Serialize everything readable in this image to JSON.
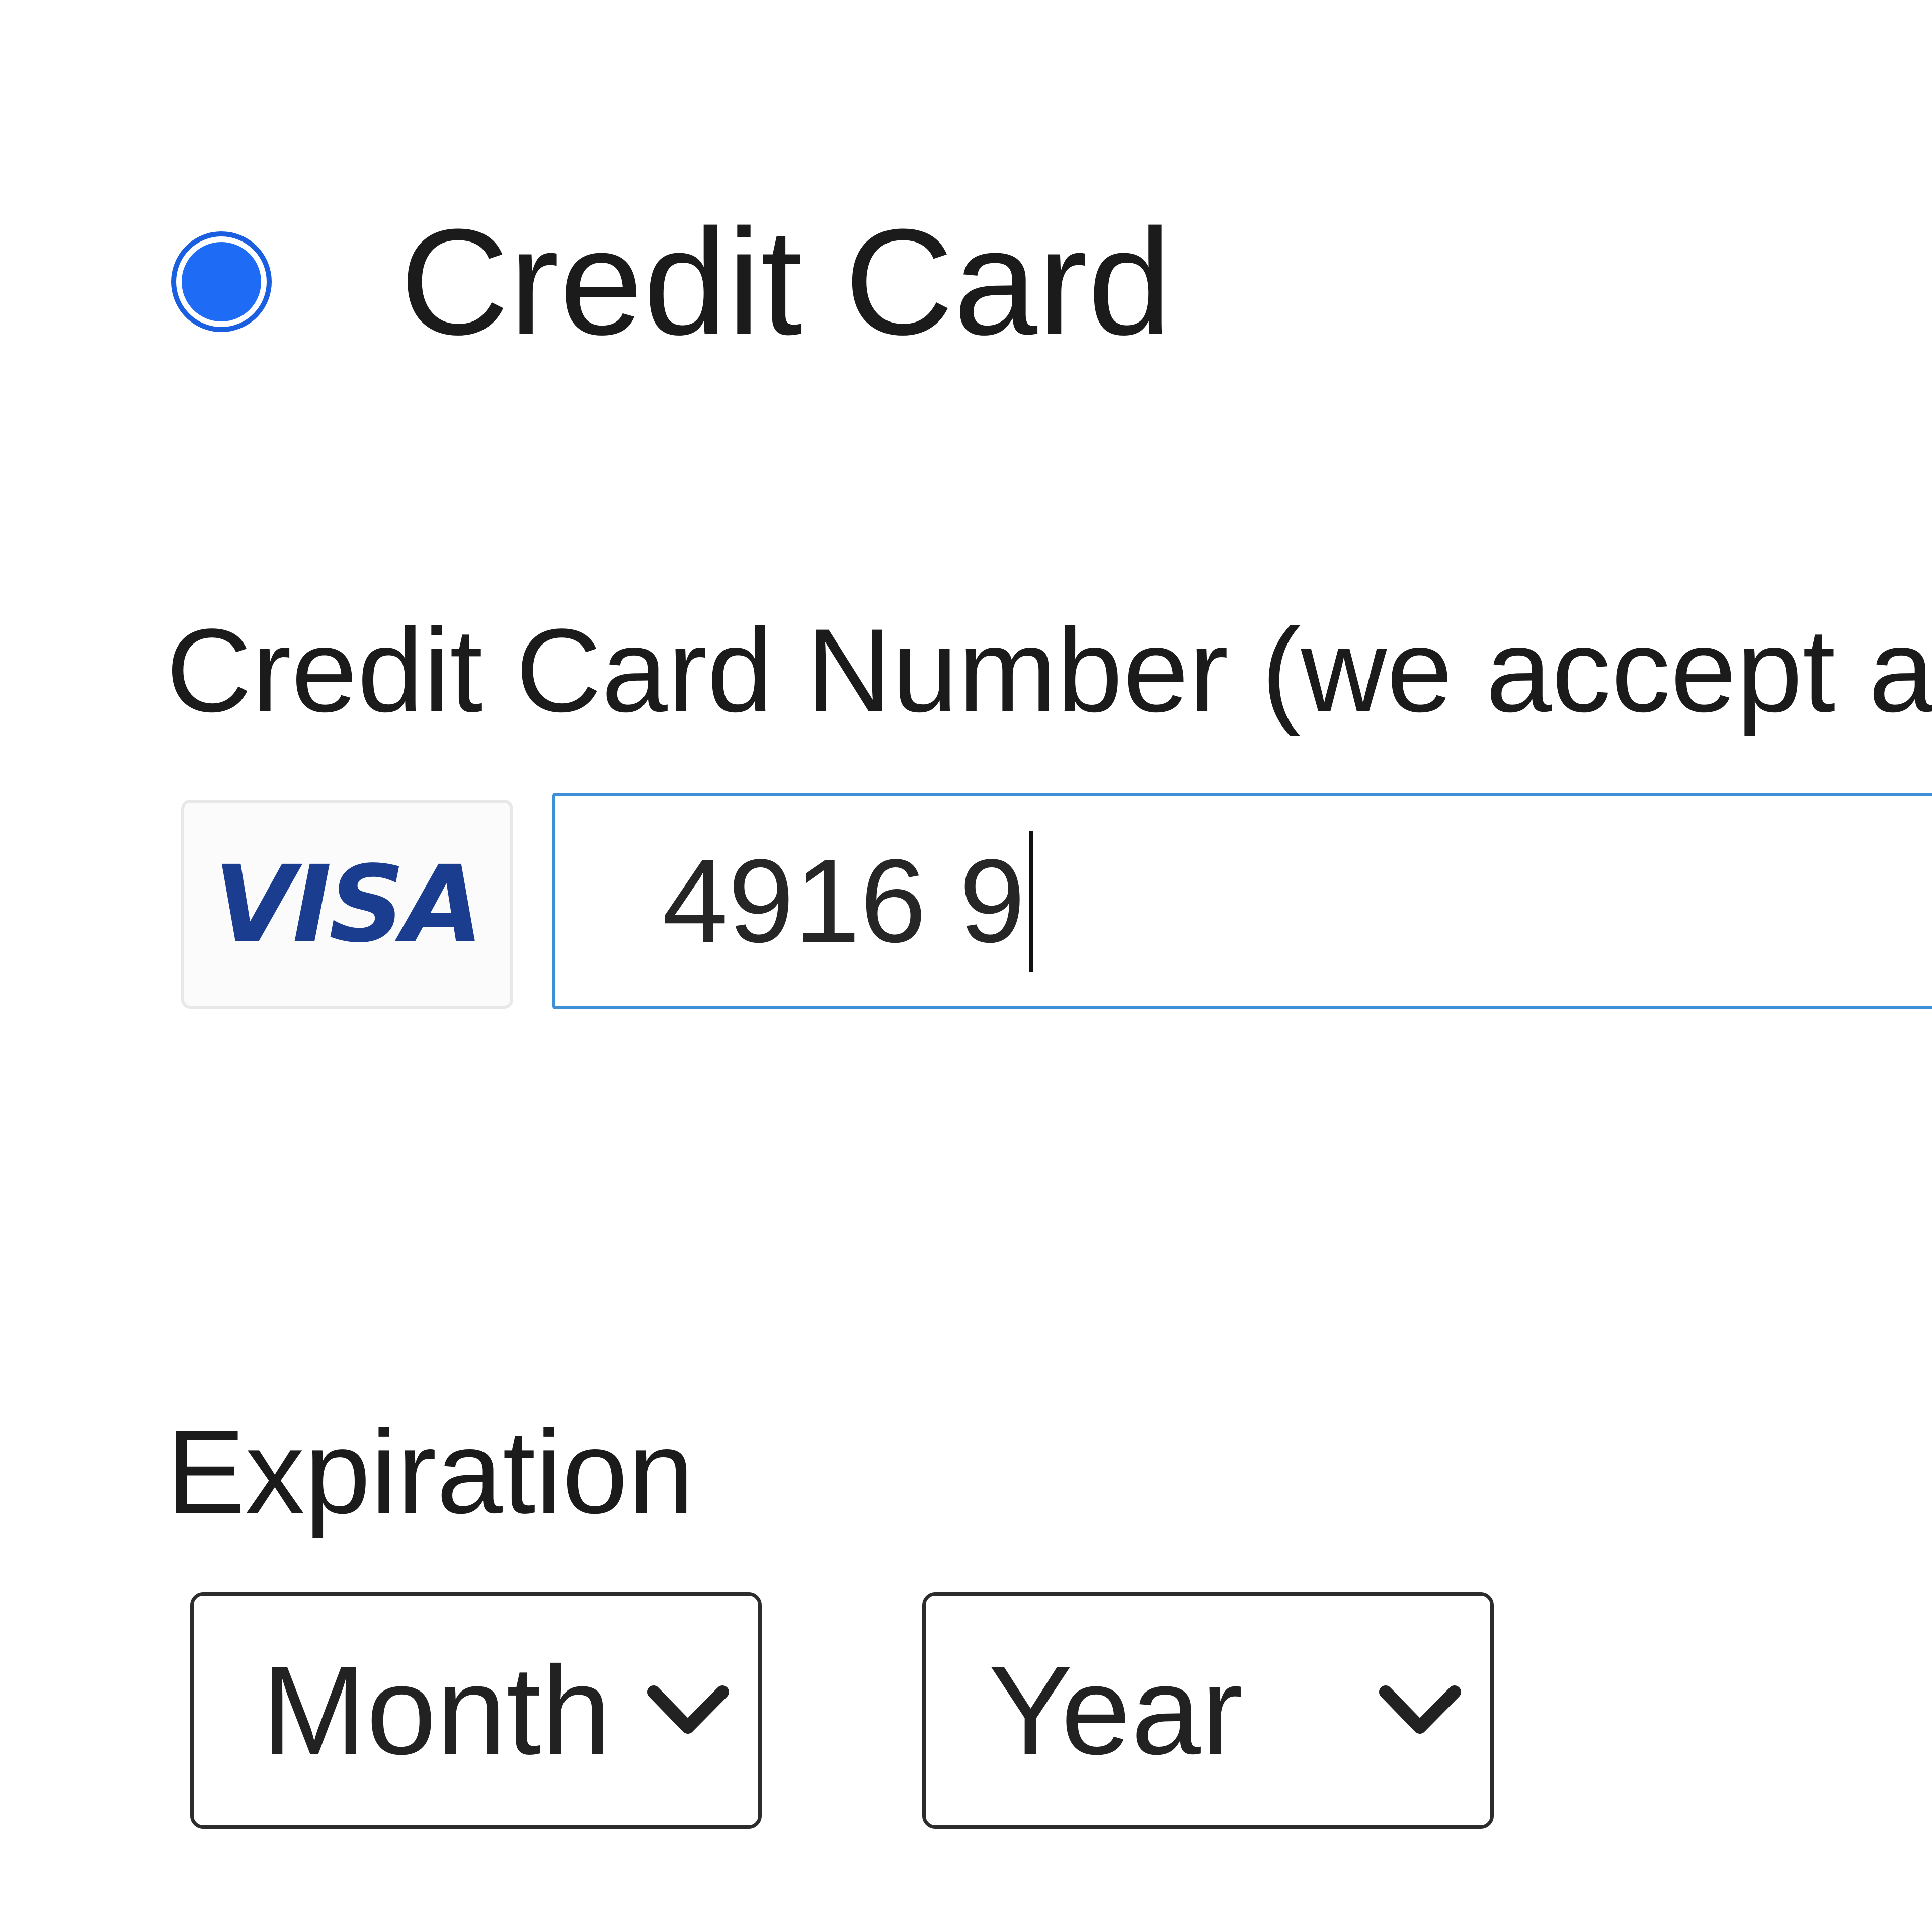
{
  "payment_method": {
    "label": "Credit Card",
    "selected": true
  },
  "card_number": {
    "label": "Credit Card Number (we accept a",
    "value": "4916 9",
    "brand": "VISA",
    "brand_icon": "visa-logo-icon"
  },
  "expiration": {
    "label": "Expiration",
    "month": {
      "selected_label": "Month"
    },
    "year": {
      "selected_label": "Year"
    }
  },
  "colors": {
    "radio_accent": "#1e6bf5",
    "input_focus_border": "#3d8fd8",
    "visa_blue": "#1a3d8f",
    "visa_gold": "#e4a126"
  }
}
